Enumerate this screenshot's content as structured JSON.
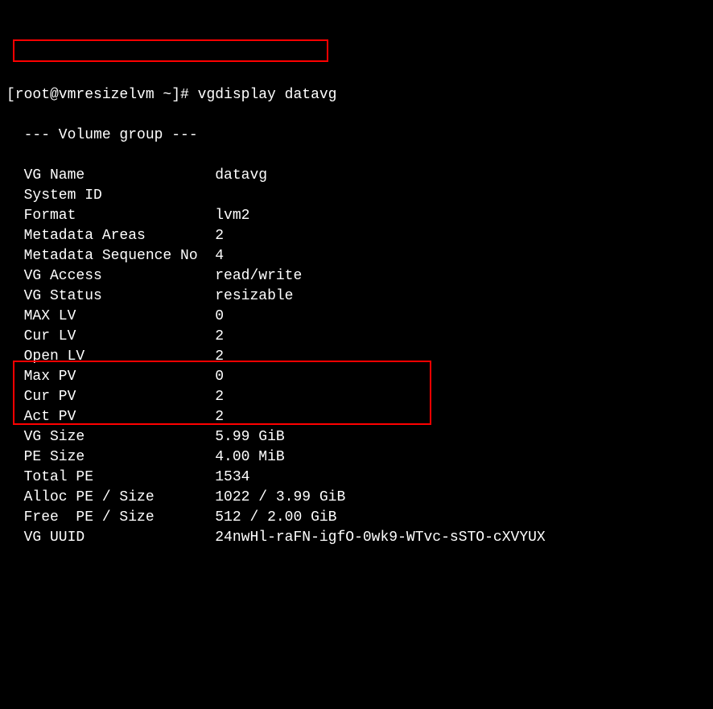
{
  "prompt": "[root@vmresizelvm ~]# ",
  "command": "vgdisplay datavg",
  "header": "  --- Volume group ---",
  "rows": [
    {
      "label": "  VG Name              ",
      "value": " datavg"
    },
    {
      "label": "  System ID            ",
      "value": ""
    },
    {
      "label": "  Format               ",
      "value": " lvm2"
    },
    {
      "label": "  Metadata Areas       ",
      "value": " 2"
    },
    {
      "label": "  Metadata Sequence No ",
      "value": " 4"
    },
    {
      "label": "  VG Access            ",
      "value": " read/write"
    },
    {
      "label": "  VG Status            ",
      "value": " resizable"
    },
    {
      "label": "  MAX LV               ",
      "value": " 0"
    },
    {
      "label": "  Cur LV               ",
      "value": " 2"
    },
    {
      "label": "  Open LV              ",
      "value": " 2"
    },
    {
      "label": "  Max PV               ",
      "value": " 0"
    },
    {
      "label": "  Cur PV               ",
      "value": " 2"
    },
    {
      "label": "  Act PV               ",
      "value": " 2"
    },
    {
      "label": "  VG Size              ",
      "value": " 5.99 GiB"
    },
    {
      "label": "  PE Size              ",
      "value": " 4.00 MiB"
    },
    {
      "label": "  Total PE             ",
      "value": " 1534"
    },
    {
      "label": "  Alloc PE / Size      ",
      "value": " 1022 / 3.99 GiB"
    },
    {
      "label": "  Free  PE / Size      ",
      "value": " 512 / 2.00 GiB"
    },
    {
      "label": "  VG UUID              ",
      "value": " 24nwHl-raFN-igfO-0wk9-WTvc-sSTO-cXVYUX"
    }
  ]
}
